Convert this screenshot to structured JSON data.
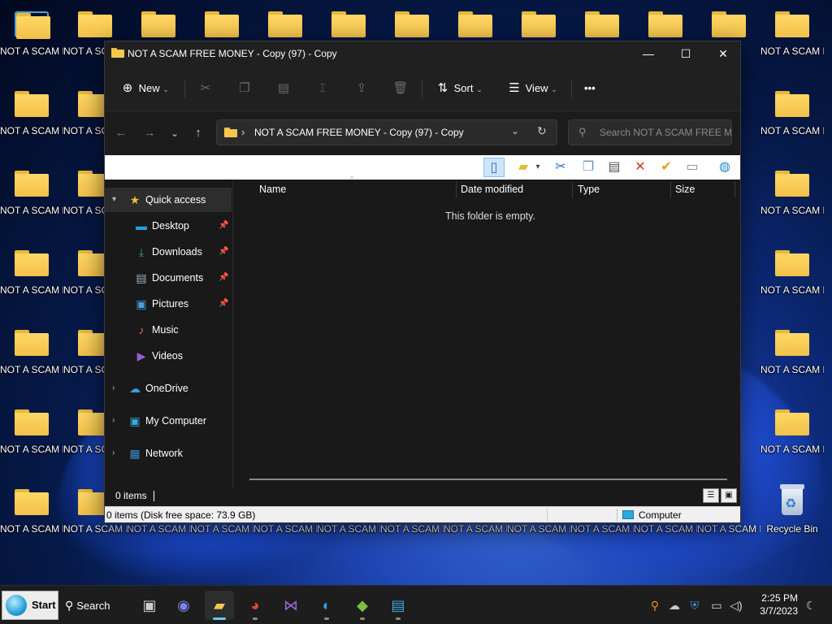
{
  "desktop": {
    "folder_label_a": "NOT A SCAM FREE MON...",
    "folder_label_b": "NOT A SCAM FREE MONE...",
    "folder_label_cut": "NOT A SC FREE MO",
    "recycle_bin_label": "Recycle Bin"
  },
  "window": {
    "title": "NOT A SCAM FREE MONEY - Copy (97) - Copy",
    "minimize": "—",
    "maximize": "☐",
    "close": "✕"
  },
  "command_bar": {
    "new_label": "New",
    "sort_label": "Sort",
    "view_label": "View",
    "more_label": "•••"
  },
  "navigation": {
    "back": "←",
    "forward": "→",
    "recent": "⌄",
    "up": "↑",
    "address": "NOT A SCAM FREE MONEY - Copy (97) - Copy",
    "search_placeholder": "Search NOT A SCAM FREE M..."
  },
  "nav_pane": {
    "quick_access": "Quick access",
    "desktop": "Desktop",
    "downloads": "Downloads",
    "documents": "Documents",
    "pictures": "Pictures",
    "music": "Music",
    "videos": "Videos",
    "onedrive": "OneDrive",
    "my_computer": "My Computer",
    "network": "Network"
  },
  "columns": {
    "name": "Name",
    "date_modified": "Date modified",
    "type": "Type",
    "size": "Size"
  },
  "content": {
    "empty_message": "This folder is empty."
  },
  "status": {
    "item_count": "0 items",
    "disk_info": "0 items (Disk free space: 73.9 GB)",
    "location": "Computer"
  },
  "taskbar": {
    "start_label": "Start",
    "search_label": "Search",
    "time": "2:25 PM",
    "date": "3/7/2023"
  },
  "colors": {
    "accent": "#60cdff",
    "folder": "#f5c84c",
    "window_bg": "#191919"
  }
}
